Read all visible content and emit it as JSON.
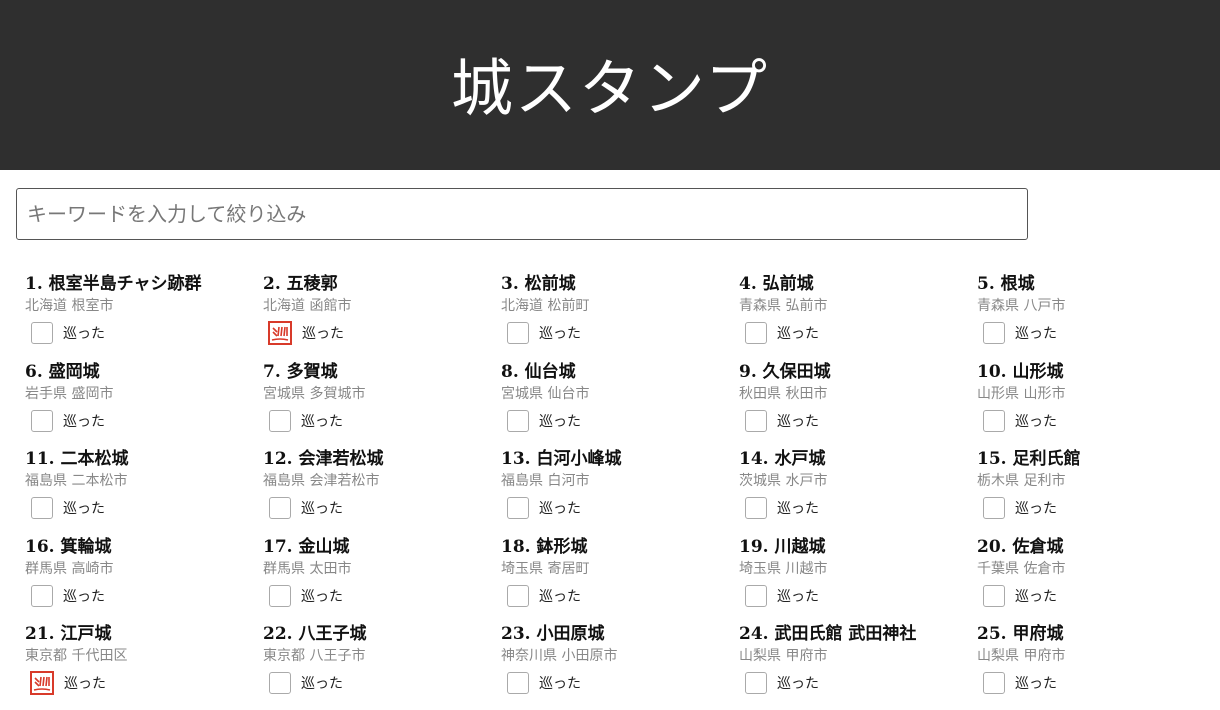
{
  "header": {
    "title": "城スタンプ"
  },
  "search": {
    "placeholder": "キーワードを入力して絞り込み"
  },
  "stamp_color": "#d83a2a",
  "castles": [
    {
      "number": "1.",
      "name": "根室半島チャシ跡群",
      "location": "北海道 根室市",
      "visited": false,
      "visit_label": "巡った"
    },
    {
      "number": "2.",
      "name": "五稜郭",
      "location": "北海道 函館市",
      "visited": true,
      "visit_label": "巡った"
    },
    {
      "number": "3.",
      "name": "松前城",
      "location": "北海道 松前町",
      "visited": false,
      "visit_label": "巡った"
    },
    {
      "number": "4.",
      "name": "弘前城",
      "location": "青森県 弘前市",
      "visited": false,
      "visit_label": "巡った"
    },
    {
      "number": "5.",
      "name": "根城",
      "location": "青森県 八戸市",
      "visited": false,
      "visit_label": "巡った"
    },
    {
      "number": "6.",
      "name": "盛岡城",
      "location": "岩手県 盛岡市",
      "visited": false,
      "visit_label": "巡った"
    },
    {
      "number": "7.",
      "name": "多賀城",
      "location": "宮城県 多賀城市",
      "visited": false,
      "visit_label": "巡った"
    },
    {
      "number": "8.",
      "name": "仙台城",
      "location": "宮城県 仙台市",
      "visited": false,
      "visit_label": "巡った"
    },
    {
      "number": "9.",
      "name": "久保田城",
      "location": "秋田県 秋田市",
      "visited": false,
      "visit_label": "巡った"
    },
    {
      "number": "10.",
      "name": "山形城",
      "location": "山形県 山形市",
      "visited": false,
      "visit_label": "巡った"
    },
    {
      "number": "11.",
      "name": "二本松城",
      "location": "福島県 二本松市",
      "visited": false,
      "visit_label": "巡った"
    },
    {
      "number": "12.",
      "name": "会津若松城",
      "location": "福島県 会津若松市",
      "visited": false,
      "visit_label": "巡った"
    },
    {
      "number": "13.",
      "name": "白河小峰城",
      "location": "福島県 白河市",
      "visited": false,
      "visit_label": "巡った"
    },
    {
      "number": "14.",
      "name": "水戸城",
      "location": "茨城県 水戸市",
      "visited": false,
      "visit_label": "巡った"
    },
    {
      "number": "15.",
      "name": "足利氏館",
      "location": "栃木県 足利市",
      "visited": false,
      "visit_label": "巡った"
    },
    {
      "number": "16.",
      "name": "箕輪城",
      "location": "群馬県 高崎市",
      "visited": false,
      "visit_label": "巡った"
    },
    {
      "number": "17.",
      "name": "金山城",
      "location": "群馬県 太田市",
      "visited": false,
      "visit_label": "巡った"
    },
    {
      "number": "18.",
      "name": "鉢形城",
      "location": "埼玉県 寄居町",
      "visited": false,
      "visit_label": "巡った"
    },
    {
      "number": "19.",
      "name": "川越城",
      "location": "埼玉県 川越市",
      "visited": false,
      "visit_label": "巡った"
    },
    {
      "number": "20.",
      "name": "佐倉城",
      "location": "千葉県 佐倉市",
      "visited": false,
      "visit_label": "巡った"
    },
    {
      "number": "21.",
      "name": "江戸城",
      "location": "東京都 千代田区",
      "visited": true,
      "visit_label": "巡った"
    },
    {
      "number": "22.",
      "name": "八王子城",
      "location": "東京都 八王子市",
      "visited": false,
      "visit_label": "巡った"
    },
    {
      "number": "23.",
      "name": "小田原城",
      "location": "神奈川県 小田原市",
      "visited": false,
      "visit_label": "巡った"
    },
    {
      "number": "24.",
      "name": "武田氏館 武田神社",
      "location": "山梨県 甲府市",
      "visited": false,
      "visit_label": "巡った"
    },
    {
      "number": "25.",
      "name": "甲府城",
      "location": "山梨県 甲府市",
      "visited": false,
      "visit_label": "巡った"
    }
  ]
}
